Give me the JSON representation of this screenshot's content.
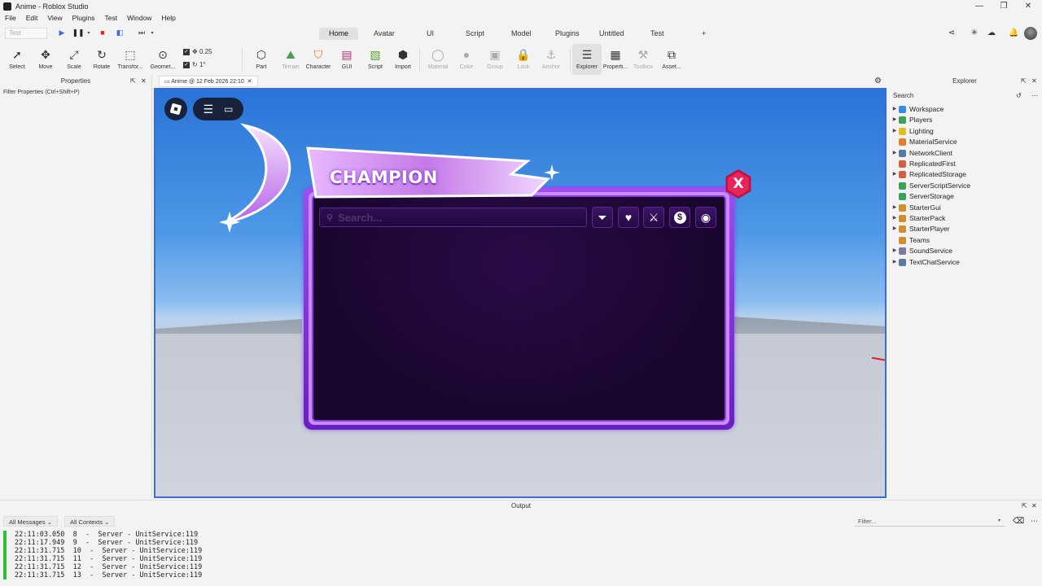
{
  "window": {
    "title": "Anime - Roblox Studio"
  },
  "menu": [
    "File",
    "Edit",
    "View",
    "Plugins",
    "Test",
    "Window",
    "Help"
  ],
  "mode_select": "Test",
  "tabs": [
    "Home",
    "Avatar",
    "UI",
    "Script",
    "Model",
    "Plugins",
    "Untitled",
    "Test",
    "+"
  ],
  "active_tab": "Home",
  "ribbon": {
    "tools": [
      "Select",
      "Move",
      "Scale",
      "Rotate",
      "Transfor...",
      "Geomet...",
      "Part",
      "Terrain",
      "Character",
      "GUI",
      "Script",
      "Import",
      "Material",
      "Color",
      "Group",
      "Lock",
      "Anchor",
      "Explorer",
      "Properti...",
      "Toolbox",
      "Asset..."
    ],
    "move_increment": "0.25",
    "rotate_increment": "1°"
  },
  "properties": {
    "title": "Properties",
    "filter_placeholder": "Filter Properties (Ctrl+Shift+P)"
  },
  "document_tab": "Anime @ 12 Feb 2026 22:10",
  "game_gui": {
    "banner_title": "CHAMPION",
    "search_placeholder": "Search...",
    "close_label": "X",
    "buttons": [
      "filter-icon",
      "heart-icon",
      "sword-icon",
      "dollar-icon",
      "eye-icon"
    ]
  },
  "explorer": {
    "title": "Explorer",
    "search_label": "Search",
    "items": [
      {
        "name": "Workspace",
        "expandable": true,
        "color": "#3a8be0"
      },
      {
        "name": "Players",
        "expandable": true,
        "color": "#3aa05a"
      },
      {
        "name": "Lighting",
        "expandable": true,
        "color": "#e0c020"
      },
      {
        "name": "MaterialService",
        "expandable": false,
        "color": "#e08030"
      },
      {
        "name": "NetworkClient",
        "expandable": true,
        "color": "#5a7aa0"
      },
      {
        "name": "ReplicatedFirst",
        "expandable": false,
        "color": "#d06040"
      },
      {
        "name": "ReplicatedStorage",
        "expandable": true,
        "color": "#d06040"
      },
      {
        "name": "ServerScriptService",
        "expandable": false,
        "color": "#3aa05a"
      },
      {
        "name": "ServerStorage",
        "expandable": false,
        "color": "#3aa05a"
      },
      {
        "name": "StarterGui",
        "expandable": true,
        "color": "#d09030"
      },
      {
        "name": "StarterPack",
        "expandable": true,
        "color": "#d09030"
      },
      {
        "name": "StarterPlayer",
        "expandable": true,
        "color": "#d09030"
      },
      {
        "name": "Teams",
        "expandable": false,
        "color": "#d09030"
      },
      {
        "name": "SoundService",
        "expandable": true,
        "color": "#7a7a9a"
      },
      {
        "name": "TextChatService",
        "expandable": true,
        "color": "#5a7aa0"
      }
    ]
  },
  "output": {
    "title": "Output",
    "messages_filter": "All Messages",
    "contexts_filter": "All Contexts",
    "filter_placeholder": "Filter...",
    "log": [
      "22:11:03.050  8  -  Server - UnitService:119",
      "22:11:17.949  9  -  Server - UnitService:119",
      "22:11:31.715  10  -  Server - UnitService:119",
      "22:11:31.715  11  -  Server - UnitService:119",
      "22:11:31.715  12  -  Server - UnitService:119",
      "22:11:31.715  13  -  Server - UnitService:119"
    ]
  }
}
